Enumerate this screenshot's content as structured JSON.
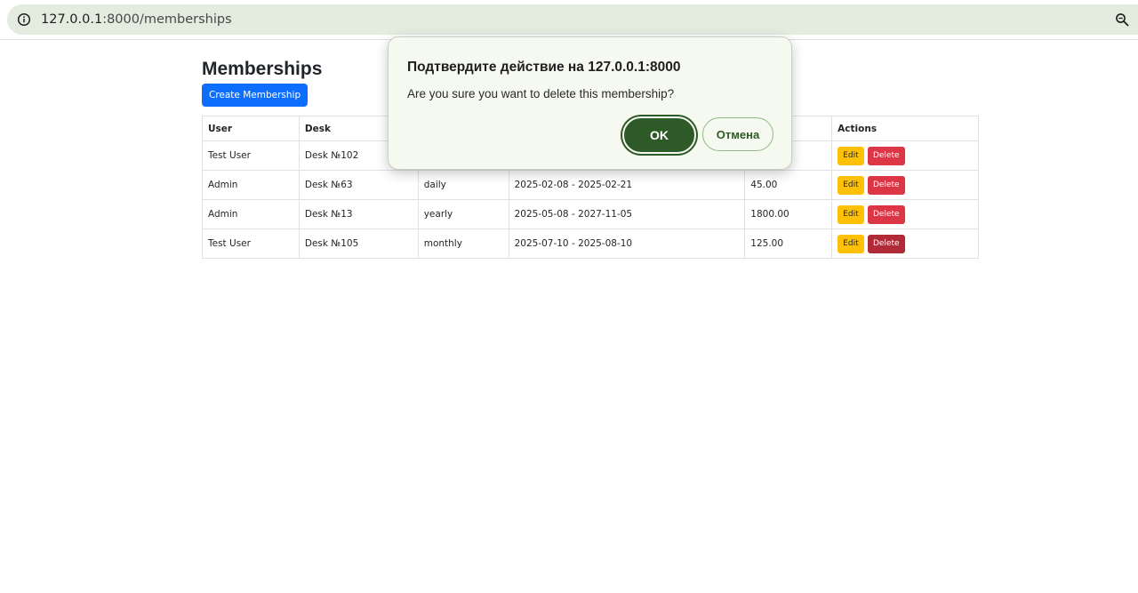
{
  "browser": {
    "url_host": "127.0.0.1",
    "url_path": ":8000/memberships"
  },
  "page": {
    "title": "Memberships",
    "create_button_label": "Create Membership"
  },
  "table": {
    "headers": {
      "user": "User",
      "desk": "Desk",
      "type": "",
      "period": "",
      "price": "",
      "actions": "Actions"
    },
    "rows": [
      {
        "user": "Test User",
        "desk": "Desk №102",
        "type": "",
        "period": "",
        "price": "",
        "edit": "Edit",
        "delete": "Delete"
      },
      {
        "user": "Admin",
        "desk": "Desk №63",
        "type": "daily",
        "period": "2025-02-08 - 2025-02-21",
        "price": "45.00",
        "edit": "Edit",
        "delete": "Delete"
      },
      {
        "user": "Admin",
        "desk": "Desk №13",
        "type": "yearly",
        "period": "2025-05-08 - 2027-11-05",
        "price": "1800.00",
        "edit": "Edit",
        "delete": "Delete"
      },
      {
        "user": "Test User",
        "desk": "Desk №105",
        "type": "monthly",
        "period": "2025-07-10 - 2025-08-10",
        "price": "125.00",
        "edit": "Edit",
        "delete": "Delete"
      }
    ]
  },
  "dialog": {
    "title": "Подтвердите действие на 127.0.0.1:8000",
    "message": "Are you sure you want to delete this membership?",
    "ok_label": "OK",
    "cancel_label": "Отмена"
  },
  "colors": {
    "primary": "#0d6efd",
    "warning": "#ffc107",
    "danger": "#dc3545",
    "dialog_accent": "#2d5a27",
    "dialog_bg": "#f6f9ef"
  },
  "icons": {
    "address_bar_left": "info-icon",
    "address_bar_right": "zoom-icon"
  }
}
